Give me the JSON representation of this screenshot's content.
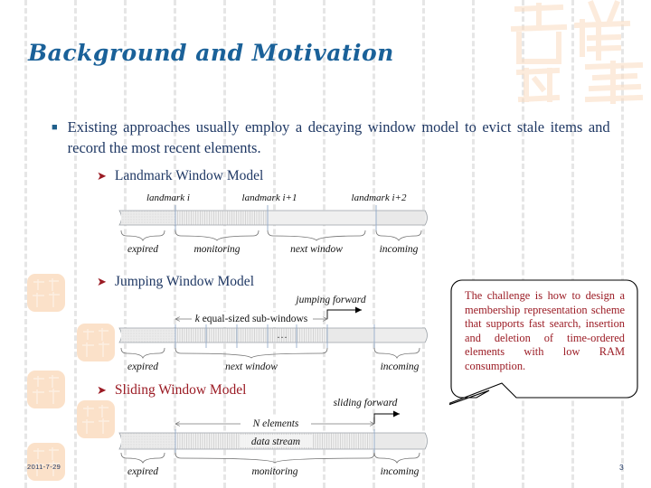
{
  "slide": {
    "title": "Background and Motivation",
    "page_number": "3",
    "footer_date": "2011-7-29",
    "colors": {
      "title_blue": "#1a6199",
      "body_navy": "#1f3864",
      "accent_red": "#9b1b24",
      "stamp_peach": "#fbdcc0",
      "grid_gray": "#e6e6e6"
    }
  },
  "bullets": {
    "main": {
      "marker": "square-bullet",
      "text": "Existing approaches usually employ a decaying window model to evict stale items and record the most recent elements."
    },
    "sub": [
      {
        "marker": "arrow-bullet",
        "label": "Landmark Window Model",
        "style": "navy"
      },
      {
        "marker": "arrow-bullet",
        "label": "Jumping Window Model",
        "style": "navy"
      },
      {
        "marker": "arrow-bullet",
        "label": "Sliding Window Model",
        "style": "red"
      }
    ]
  },
  "diagrams": {
    "landmark": {
      "name": "Landmark Window Model",
      "top_labels": [
        "landmark i",
        "landmark i+1",
        "landmark i+2"
      ],
      "bottom_labels": [
        "expired",
        "monitoring",
        "next window",
        "incoming"
      ]
    },
    "jumping": {
      "name": "Jumping Window Model",
      "span_label": "k equal-sized sub-windows",
      "arrow_label": "jumping forward",
      "ellipsis": "…",
      "bottom_labels": [
        "expired",
        "next window",
        "incoming"
      ]
    },
    "sliding": {
      "name": "Sliding Window Model",
      "span_label": "N elements",
      "bar_label": "data stream",
      "arrow_label": "sliding forward",
      "bottom_labels": [
        "expired",
        "monitoring",
        "incoming"
      ]
    }
  },
  "callout": {
    "text": "The challenge is how to design a membership representation scheme that supports fast search, insertion and deletion of time-ordered elements with low RAM consumption."
  }
}
